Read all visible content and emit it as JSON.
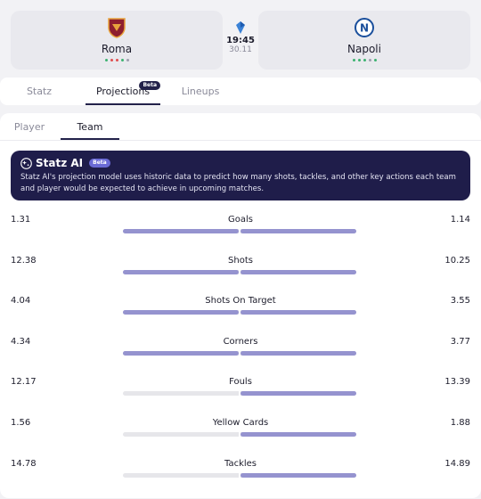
{
  "match": {
    "home": {
      "name": "Roma",
      "form": [
        "#3cb371",
        "#e04e4e",
        "#e04e4e",
        "#3cb371",
        "#9e9eae"
      ]
    },
    "away": {
      "name": "Napoli",
      "form": [
        "#3cb371",
        "#3cb371",
        "#3cb371",
        "#9e9eae",
        "#3cb371"
      ]
    },
    "time": "19:45",
    "date": "30.11"
  },
  "tabs": {
    "statz": "Statz",
    "projections": "Projections",
    "projections_badge": "Beta",
    "lineups": "Lineups"
  },
  "subtabs": {
    "player": "Player",
    "team": "Team"
  },
  "ai": {
    "title": "Statz AI",
    "badge": "Beta",
    "description": "Statz AI's projection model uses historic data to predict how many shots, tackles, and other key actions each team and player would be expected to achieve in upcoming matches."
  },
  "stats": [
    {
      "label": "Goals",
      "home": "1.31",
      "away": "1.14",
      "home_fill": 1.0,
      "away_fill": 1.0
    },
    {
      "label": "Shots",
      "home": "12.38",
      "away": "10.25",
      "home_fill": 1.0,
      "away_fill": 1.0
    },
    {
      "label": "Shots On Target",
      "home": "4.04",
      "away": "3.55",
      "home_fill": 1.0,
      "away_fill": 1.0
    },
    {
      "label": "Corners",
      "home": "4.34",
      "away": "3.77",
      "home_fill": 1.0,
      "away_fill": 1.0
    },
    {
      "label": "Fouls",
      "home": "12.17",
      "away": "13.39",
      "home_fill": 0.0,
      "away_fill": 1.0
    },
    {
      "label": "Yellow Cards",
      "home": "1.56",
      "away": "1.88",
      "home_fill": 0.0,
      "away_fill": 1.0
    },
    {
      "label": "Tackles",
      "home": "14.78",
      "away": "14.89",
      "home_fill": 0.0,
      "away_fill": 1.0
    }
  ],
  "colors": {
    "accent_dark": "#23224a",
    "bar_fill": "#9593cf",
    "bar_track": "#e6e6ea"
  }
}
